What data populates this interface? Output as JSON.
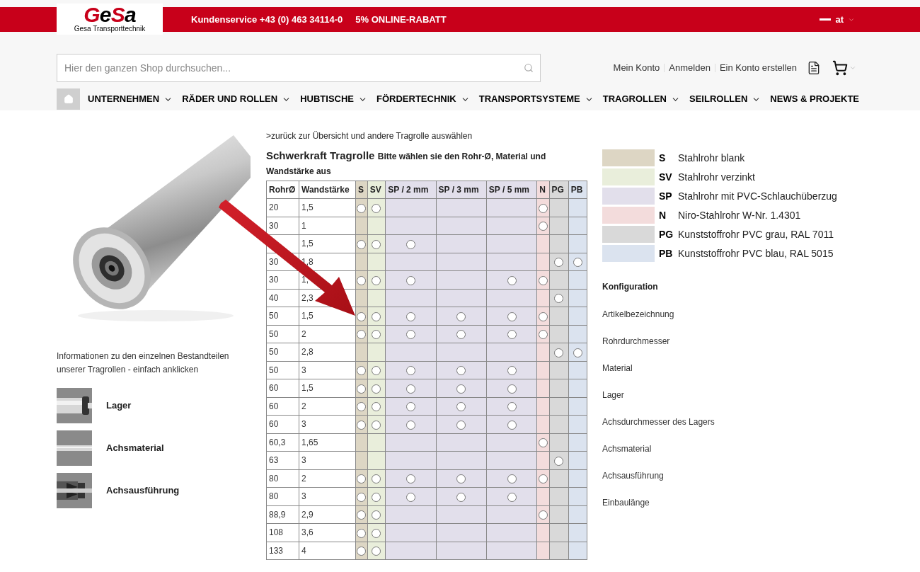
{
  "header": {
    "logo": {
      "wordmark": "GeSa",
      "subtitle": "Gesa Transporttechnik"
    },
    "topbar": {
      "service": "Kundenservice +43 (0) 463 34114-0",
      "promo": "5% ONLINE-RABATT",
      "language": "at"
    },
    "search": {
      "placeholder": "Hier den ganzen Shop durchsuchen..."
    },
    "account_links": [
      "Mein Konto",
      "Anmelden",
      "Ein Konto erstellen"
    ]
  },
  "nav": [
    {
      "label": "UNTERNEHMEN",
      "dropdown": true
    },
    {
      "label": "RÄDER UND ROLLEN",
      "dropdown": true
    },
    {
      "label": "HUBTISCHE",
      "dropdown": true
    },
    {
      "label": "FÖRDERTECHNIK",
      "dropdown": true
    },
    {
      "label": "TRANSPORTSYSTEME",
      "dropdown": true
    },
    {
      "label": "TRAGROLLEN",
      "dropdown": true
    },
    {
      "label": "SEILROLLEN",
      "dropdown": true
    },
    {
      "label": "NEWS & PROJEKTE",
      "dropdown": false
    }
  ],
  "info": {
    "text": "Informationen zu den einzelnen Bestandteilen unserer Tragrollen - einfach anklicken",
    "parts": [
      {
        "label": "Lager",
        "kind": "bearing"
      },
      {
        "label": "Achsmaterial",
        "kind": "axle"
      },
      {
        "label": "Achsausführung",
        "kind": "thread"
      }
    ]
  },
  "back_link": ">zurück zur Übersicht und andere Tragrolle auswählen",
  "heading": {
    "title": "Schwerkraft Tragrolle",
    "subtitle": "Bitte wählen sie den Rohr-Ø, Material und Wandstärke aus"
  },
  "table": {
    "columns": [
      {
        "label": "RohrØ"
      },
      {
        "label": "Wandstärke"
      },
      {
        "label": "S",
        "color": "#ddd6c4"
      },
      {
        "label": "SV",
        "color": "#e9eedb"
      },
      {
        "label": "SP / 2 mm",
        "color": "#e2dfeb"
      },
      {
        "label": "SP / 3 mm",
        "color": "#e2dfeb"
      },
      {
        "label": "SP / 5 mm",
        "color": "#e2dfeb"
      },
      {
        "label": "N",
        "color": "#f3dcdc"
      },
      {
        "label": "PG",
        "color": "#d9d9d9"
      },
      {
        "label": "PB",
        "color": "#dbe3ef"
      }
    ],
    "rows": [
      {
        "rohr": "20",
        "wand": "1,5",
        "options": [
          true,
          true,
          false,
          false,
          false,
          true,
          false,
          false
        ]
      },
      {
        "rohr": "30",
        "wand": "1",
        "options": [
          false,
          false,
          false,
          false,
          false,
          true,
          false,
          false
        ]
      },
      {
        "wand": "1,5",
        "options": [
          true,
          true,
          true,
          false,
          false,
          false,
          false,
          false
        ]
      },
      {
        "rohr": "30",
        "wand": "1,8",
        "options": [
          false,
          false,
          false,
          false,
          false,
          false,
          true,
          true
        ]
      },
      {
        "rohr": "30",
        "wand": "1,",
        "options": [
          true,
          true,
          true,
          false,
          true,
          true,
          false,
          false
        ]
      },
      {
        "rohr": "40",
        "wand": "2,3",
        "options": [
          false,
          false,
          false,
          false,
          false,
          false,
          true,
          false
        ]
      },
      {
        "rohr": "50",
        "wand": "1,5",
        "options": [
          true,
          true,
          true,
          true,
          true,
          true,
          false,
          false
        ]
      },
      {
        "rohr": "50",
        "wand": "2",
        "options": [
          true,
          true,
          true,
          true,
          true,
          true,
          false,
          false
        ]
      },
      {
        "rohr": "50",
        "wand": "2,8",
        "options": [
          false,
          false,
          false,
          false,
          false,
          false,
          true,
          true
        ]
      },
      {
        "rohr": "50",
        "wand": "3",
        "options": [
          true,
          true,
          true,
          true,
          true,
          false,
          false,
          false
        ]
      },
      {
        "rohr": "60",
        "wand": "1,5",
        "options": [
          true,
          true,
          true,
          true,
          true,
          false,
          false,
          false
        ]
      },
      {
        "rohr": "60",
        "wand": "2",
        "options": [
          true,
          true,
          true,
          true,
          true,
          false,
          false,
          false
        ]
      },
      {
        "rohr": "60",
        "wand": "3",
        "options": [
          true,
          true,
          true,
          true,
          true,
          false,
          false,
          false
        ]
      },
      {
        "rohr": "60,3",
        "wand": "1,65",
        "options": [
          false,
          false,
          false,
          false,
          false,
          true,
          false,
          false
        ]
      },
      {
        "rohr": "63",
        "wand": "3",
        "options": [
          false,
          false,
          false,
          false,
          false,
          false,
          true,
          false
        ]
      },
      {
        "rohr": "80",
        "wand": "2",
        "options": [
          true,
          true,
          true,
          true,
          true,
          true,
          false,
          false
        ]
      },
      {
        "rohr": "80",
        "wand": "3",
        "options": [
          true,
          true,
          true,
          true,
          true,
          false,
          false,
          false
        ]
      },
      {
        "rohr": "88,9",
        "wand": "2,9",
        "options": [
          true,
          true,
          false,
          false,
          false,
          true,
          false,
          false
        ]
      },
      {
        "rohr": "108",
        "wand": "3,6",
        "options": [
          true,
          true,
          false,
          false,
          false,
          false,
          false,
          false
        ]
      },
      {
        "rohr": "133",
        "wand": "4",
        "options": [
          true,
          true,
          false,
          false,
          false,
          false,
          false,
          false
        ]
      }
    ]
  },
  "legend": [
    {
      "code": "S",
      "text": "Stahlrohr blank",
      "color": "#ddd6c4"
    },
    {
      "code": "SV",
      "text": "Stahlrohr verzinkt",
      "color": "#e9eedb"
    },
    {
      "code": "SP",
      "text": "Stahlrohr mit PVC-Schlauchüberzug",
      "color": "#e2dfeb"
    },
    {
      "code": "N",
      "text": "Niro-Stahlrohr W-Nr. 1.4301",
      "color": "#f3dcdc"
    },
    {
      "code": "PG",
      "text": "Kunststoffrohr PVC grau, RAL 7011",
      "color": "#d9d9d9"
    },
    {
      "code": "PB",
      "text": "Kunststoffrohr PVC blau, RAL 5015",
      "color": "#dbe3ef"
    }
  ],
  "configuration": {
    "title": "Konfiguration",
    "items": [
      "Artikelbezeichnung",
      "Rohrdurchmesser",
      "Material",
      "Lager",
      "Achsdurchmesser des Lagers",
      "Achsmaterial",
      "Achsausführung",
      "Einbaulänge"
    ]
  }
}
